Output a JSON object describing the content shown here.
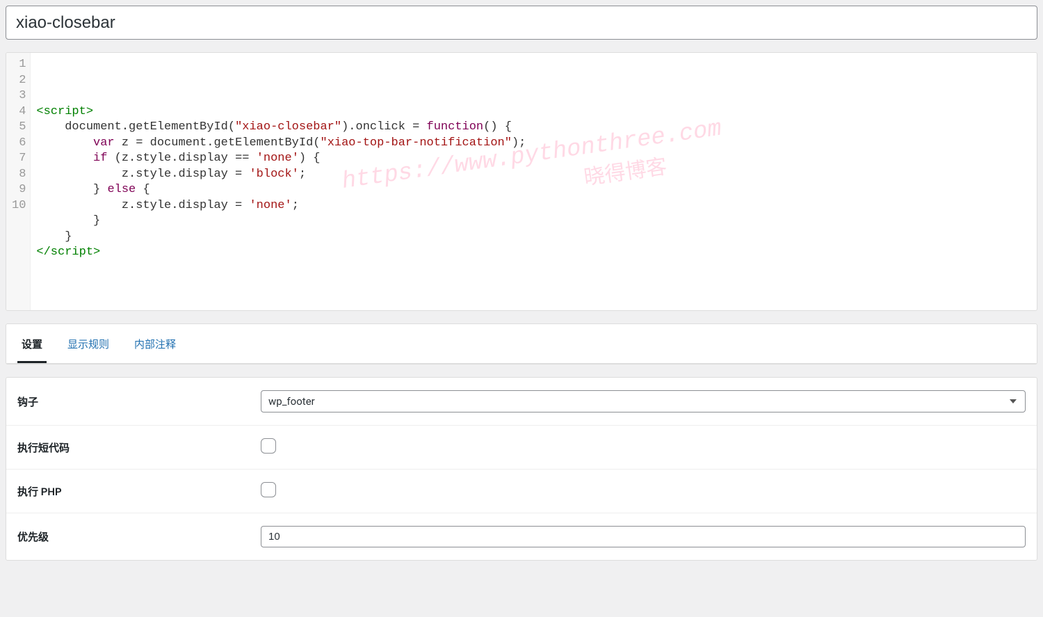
{
  "title": "xiao-closebar",
  "code": {
    "line_count": 10,
    "lines": [
      [
        {
          "c": "tok-tag",
          "t": "<script>"
        }
      ],
      [
        {
          "c": "tok-plain",
          "t": "    document.getElementById("
        },
        {
          "c": "tok-str",
          "t": "\"xiao-closebar\""
        },
        {
          "c": "tok-plain",
          "t": ").onclick = "
        },
        {
          "c": "tok-kw",
          "t": "function"
        },
        {
          "c": "tok-plain",
          "t": "() {"
        }
      ],
      [
        {
          "c": "tok-plain",
          "t": "        "
        },
        {
          "c": "tok-var",
          "t": "var"
        },
        {
          "c": "tok-plain",
          "t": " z = document.getElementById("
        },
        {
          "c": "tok-str",
          "t": "\"xiao-top-bar-notification\""
        },
        {
          "c": "tok-plain",
          "t": ");"
        }
      ],
      [
        {
          "c": "tok-plain",
          "t": "        "
        },
        {
          "c": "tok-kw",
          "t": "if"
        },
        {
          "c": "tok-plain",
          "t": " (z.style.display == "
        },
        {
          "c": "tok-str",
          "t": "'none'"
        },
        {
          "c": "tok-plain",
          "t": ") {"
        }
      ],
      [
        {
          "c": "tok-plain",
          "t": "            z.style.display = "
        },
        {
          "c": "tok-str",
          "t": "'block'"
        },
        {
          "c": "tok-plain",
          "t": ";"
        }
      ],
      [
        {
          "c": "tok-plain",
          "t": "        } "
        },
        {
          "c": "tok-kw",
          "t": "else"
        },
        {
          "c": "tok-plain",
          "t": " {"
        }
      ],
      [
        {
          "c": "tok-plain",
          "t": "            z.style.display = "
        },
        {
          "c": "tok-str",
          "t": "'none'"
        },
        {
          "c": "tok-plain",
          "t": ";"
        }
      ],
      [
        {
          "c": "tok-plain",
          "t": "        }"
        }
      ],
      [
        {
          "c": "tok-plain",
          "t": "    }"
        }
      ],
      [
        {
          "c": "tok-tag",
          "t": "</scr"
        },
        {
          "c": "tok-tag",
          "t": "ipt>"
        }
      ]
    ]
  },
  "watermark": {
    "line1": "https://www.pythonthree.com",
    "line2": "晓得博客"
  },
  "tabs": {
    "settings": "设置",
    "display_rules": "显示规则",
    "notes": "内部注释"
  },
  "settings": {
    "hook_label": "钩子",
    "hook_value": "wp_footer",
    "shortcode_label": "执行短代码",
    "shortcode_checked": false,
    "php_label": "执行 PHP",
    "php_checked": false,
    "priority_label": "优先级",
    "priority_value": "10"
  }
}
